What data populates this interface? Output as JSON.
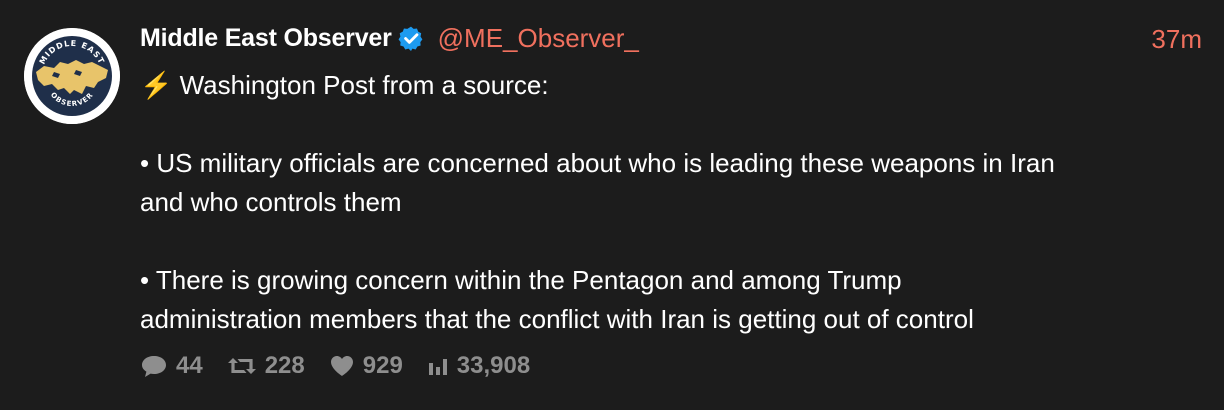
{
  "tweet": {
    "author_name": "Middle East Observer",
    "handle": "@ME_Observer_",
    "time_ago": "37m",
    "verified": true,
    "lines": [
      "⚡ Washington Post from a source:",
      "",
      "• US military officials are concerned about who is leading these weapons in Iran",
      "and who controls them",
      "",
      "• There is growing concern within the Pentagon and among Trump",
      "administration members that the conflict with Iran is getting out of control"
    ],
    "stats": {
      "replies": "44",
      "retweets": "228",
      "likes": "929",
      "views": "33,908"
    },
    "avatar_logo_text": "MIDDLE EAST OBSERVER"
  },
  "colors": {
    "background": "#1c1c1c",
    "accent": "#f0705e",
    "muted": "#8e8e8e",
    "verified": "#1d9bf0",
    "logo_navy": "#1f2f4a",
    "logo_gold": "#e8c46a"
  },
  "icons": {
    "verified": "verified-badge-icon",
    "replies": "comment-icon",
    "retweets": "retweet-icon",
    "likes": "heart-icon",
    "views": "bar-chart-icon"
  }
}
